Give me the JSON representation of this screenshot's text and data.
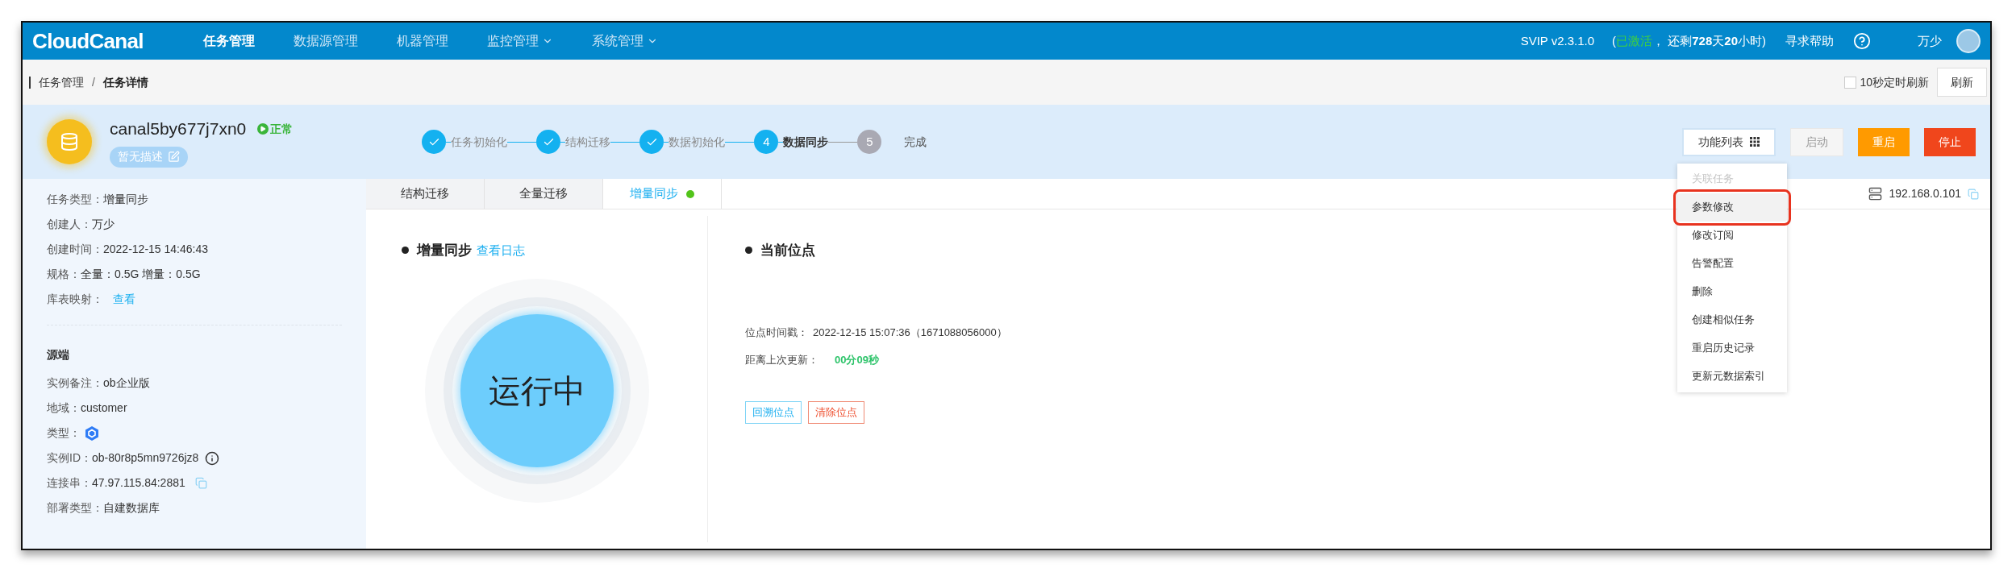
{
  "nav": {
    "logo": "CloudCanal",
    "items": [
      {
        "label": "任务管理",
        "selected": true,
        "dropdown": false
      },
      {
        "label": "数据源管理",
        "selected": false,
        "dropdown": false
      },
      {
        "label": "机器管理",
        "selected": false,
        "dropdown": false
      },
      {
        "label": "监控管理",
        "selected": false,
        "dropdown": true
      },
      {
        "label": "系统管理",
        "selected": false,
        "dropdown": true
      }
    ],
    "version": "SVIP v2.3.1.0",
    "license": {
      "open": "(",
      "status": "已激活",
      "rest": "， 还剩**728**天**20**小时)"
    },
    "help": "寻求帮助",
    "user": "万少"
  },
  "breadcrumb": {
    "items": [
      "任务管理",
      "任务详情"
    ],
    "separator": "/",
    "auto_refresh": {
      "label": "10秒定时刷新",
      "checked": false
    },
    "refresh": "刷新"
  },
  "task": {
    "name": "canal5by677j7xn0",
    "status": "正常",
    "description": "暂无描述",
    "steps": [
      {
        "label": "任务初始化",
        "done": true,
        "active": false
      },
      {
        "label": "结构迁移",
        "done": true,
        "active": false
      },
      {
        "label": "数据初始化",
        "done": true,
        "active": false
      },
      {
        "number": "4",
        "label": "数据同步",
        "done": false,
        "active": true
      },
      {
        "number": "5",
        "label": "完成",
        "done": false,
        "active": false
      }
    ],
    "actions": [
      {
        "label": "功能列表",
        "kind": "menu",
        "disabled": false
      },
      {
        "label": "启动",
        "kind": "plain",
        "disabled": true
      },
      {
        "label": "重启",
        "kind": "warning",
        "disabled": false
      },
      {
        "label": "停止",
        "kind": "danger",
        "disabled": false
      }
    ],
    "menu": [
      {
        "label": "关联任务",
        "disabled": true,
        "highlighted": false
      },
      {
        "label": "参数修改",
        "disabled": false,
        "highlighted": true
      },
      {
        "label": "修改订阅",
        "disabled": false,
        "highlighted": false
      },
      {
        "label": "告警配置",
        "disabled": false,
        "highlighted": false
      },
      {
        "label": "删除",
        "disabled": false,
        "highlighted": false
      },
      {
        "label": "创建相似任务",
        "disabled": false,
        "highlighted": false
      },
      {
        "label": "重启历史记录",
        "disabled": false,
        "highlighted": false
      },
      {
        "label": "更新元数据索引",
        "disabled": false,
        "highlighted": false
      }
    ]
  },
  "info": {
    "rows": [
      {
        "label": "任务类型：",
        "value": "增量同步",
        "kind": "text"
      },
      {
        "label": "创建人：",
        "value": "万少",
        "kind": "text"
      },
      {
        "label": "创建时间：",
        "value": "2022-12-15 14:46:43",
        "kind": "text"
      },
      {
        "label": "规格：",
        "value": "全量：0.5G 增量：0.5G",
        "kind": "text"
      },
      {
        "label": "库表映射：",
        "value": "查看",
        "kind": "link"
      }
    ],
    "source_title": "源端",
    "source_rows": [
      {
        "label": "实例备注：",
        "value": "ob企业版",
        "kind": "text"
      },
      {
        "label": "地域：",
        "value": "customer",
        "kind": "text"
      },
      {
        "label": "类型：",
        "kind": "db-type"
      },
      {
        "label": "实例ID：",
        "value": "ob-80r8p5mn9726jz8",
        "kind": "info"
      },
      {
        "label": "连接串：",
        "value": "47.97.115.84:2881",
        "kind": "copy"
      },
      {
        "label": "部署类型：",
        "value": "自建数据库",
        "kind": "text"
      }
    ]
  },
  "tabs": [
    {
      "label": "结构迁移",
      "selected": false,
      "running": false
    },
    {
      "label": "全量迁移",
      "selected": false,
      "running": false
    },
    {
      "label": "增量同步",
      "selected": true,
      "running": true
    }
  ],
  "host": "192.168.0.101",
  "sync": {
    "title": "增量同步",
    "log_link": "查看日志",
    "state": "运行中"
  },
  "position": {
    "title": "当前位点",
    "rows": [
      {
        "label": "位点时间戳：",
        "value": "2022-12-15 15:07:36（1671088056000）",
        "kind": "text"
      },
      {
        "label": "距离上次更新：",
        "value": "00分09秒",
        "kind": "fresh"
      }
    ],
    "buttons": [
      {
        "label": "回溯位点",
        "kind": "primary"
      },
      {
        "label": "清除位点",
        "kind": "danger"
      }
    ]
  }
}
